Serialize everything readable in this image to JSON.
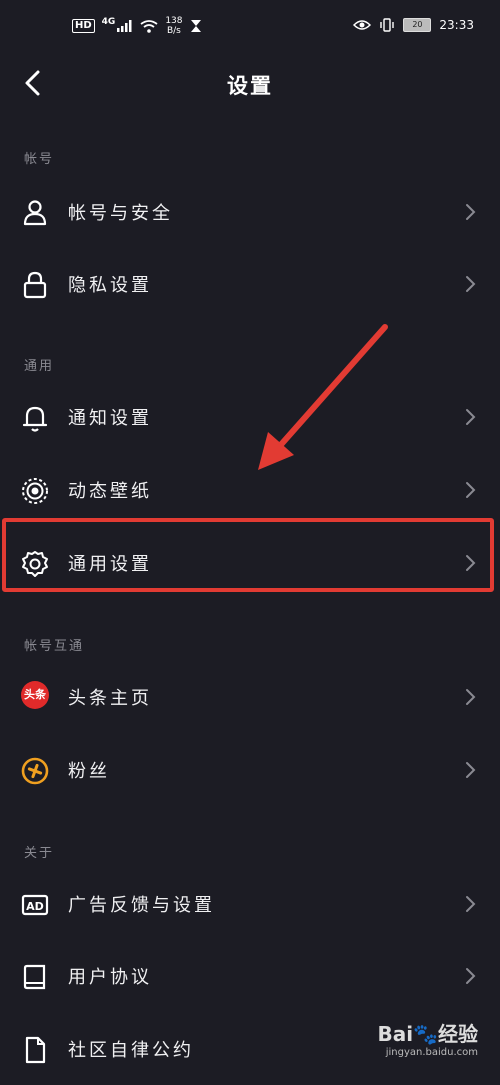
{
  "status_bar": {
    "hd": "HD",
    "network": "4G",
    "speed_value": "138",
    "speed_unit": "B/s",
    "battery": "20",
    "time": "23:33"
  },
  "header": {
    "title": "设置"
  },
  "sections": {
    "account": "帐号",
    "general": "通用",
    "interop": "帐号互通",
    "about": "关于"
  },
  "rows": {
    "account_security": "帐号与安全",
    "privacy": "隐私设置",
    "notifications": "通知设置",
    "wallpaper": "动态壁纸",
    "general_settings": "通用设置",
    "toutiao": "头条主页",
    "toutiao_badge": "头条",
    "fans": "粉丝",
    "ads": "广告反馈与设置",
    "user_agreement": "用户协议",
    "community": "社区自律公约"
  },
  "icons": {
    "back": "chevron-left-icon",
    "account_security": "user-icon",
    "privacy": "lock-icon",
    "notifications": "bell-icon",
    "wallpaper": "wallpaper-icon",
    "general_settings": "gear-icon",
    "fans": "fans-icon",
    "ads": "ad-icon",
    "user_agreement": "book-icon",
    "community": "document-icon",
    "chevron": "chevron-right-icon"
  },
  "colors": {
    "background": "#1c1c24",
    "highlight": "#e23b33",
    "toutiao": "#e02a2a",
    "fans_accent": "#f0a020"
  },
  "watermark": {
    "logo": "Bai🐾经验",
    "url": "jingyan.baidu.com"
  }
}
